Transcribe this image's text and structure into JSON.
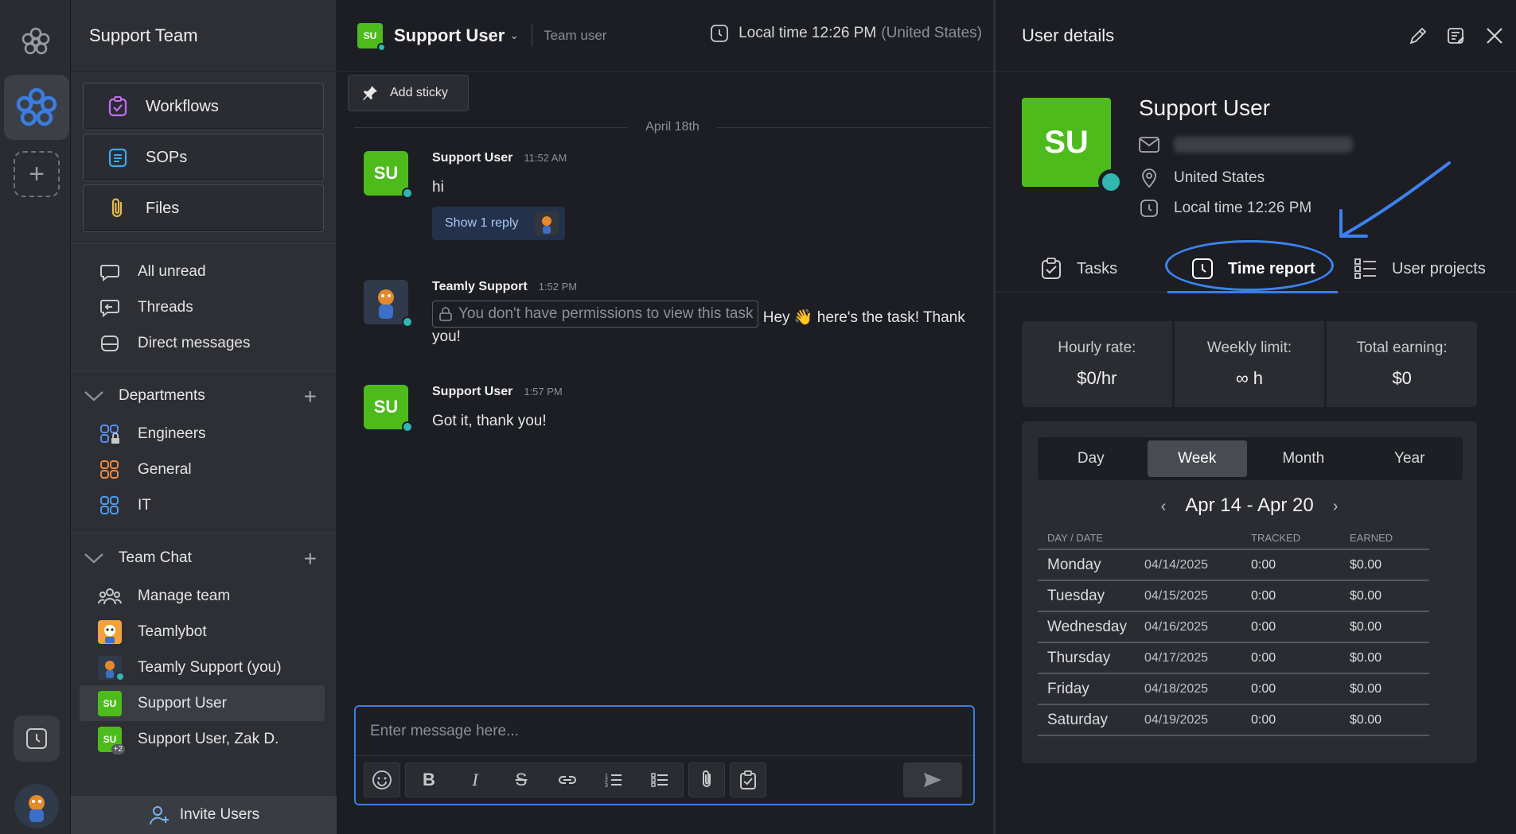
{
  "sidebar": {
    "team_name": "Support Team",
    "primary": [
      {
        "label": "Workflows",
        "icon": "workflows-icon",
        "color": "#c46df2"
      },
      {
        "label": "SOPs",
        "icon": "sops-icon",
        "color": "#3fa7f0"
      },
      {
        "label": "Files",
        "icon": "paperclip-icon",
        "color": "#e7b94a"
      }
    ],
    "quick": [
      {
        "label": "All unread",
        "icon": "all-unread-icon"
      },
      {
        "label": "Threads",
        "icon": "threads-icon"
      },
      {
        "label": "Direct messages",
        "icon": "direct-messages-icon"
      }
    ],
    "departments": {
      "title": "Departments",
      "items": [
        {
          "label": "Engineers",
          "color": "#5a8cf0"
        },
        {
          "label": "General",
          "color": "#f08a3e"
        },
        {
          "label": "IT",
          "color": "#4c9cf0"
        }
      ]
    },
    "team_chat": {
      "title": "Team Chat",
      "items": [
        {
          "label": "Manage team"
        },
        {
          "label": "Teamlybot"
        },
        {
          "label": "Teamly Support (you)"
        },
        {
          "label": "Support User",
          "avatar": "SU"
        },
        {
          "label": "Support User, Zak D.",
          "avatar": "SU",
          "badge": "+2"
        }
      ]
    },
    "invite_label": "Invite Users"
  },
  "chat": {
    "header": {
      "avatar": "SU",
      "name": "Support User",
      "role": "Team user",
      "local_time": "Local time 12:26 PM",
      "country": "(United States)"
    },
    "sticky_label": "Add sticky",
    "date_divider": "April 18th",
    "messages": [
      {
        "author": "Support User",
        "time": "11:52 AM",
        "text": "hi",
        "avatar": "SU",
        "reply_label": "Show 1 reply"
      },
      {
        "author": "Teamly Support",
        "time": "1:52 PM",
        "permission": "You don't have permissions to view this task",
        "text": "Hey 👋 here's the task! Thank",
        "text2": "you!"
      },
      {
        "author": "Support User",
        "time": "1:57 PM",
        "text": "Got it, thank you!",
        "avatar": "SU"
      }
    ],
    "composer_placeholder": "Enter message here..."
  },
  "panel": {
    "title": "User details",
    "user": {
      "initials": "SU",
      "name": "Support User",
      "location": "United States",
      "local_time": "Local time 12:26 PM"
    },
    "tabs": [
      {
        "label": "Tasks"
      },
      {
        "label": "Time report"
      },
      {
        "label": "User projects"
      }
    ],
    "stats": [
      {
        "label": "Hourly rate:",
        "value": "$0/hr"
      },
      {
        "label": "Weekly limit:",
        "value": "∞ h"
      },
      {
        "label": "Total earning:",
        "value": "$0"
      }
    ],
    "periods": [
      "Day",
      "Week",
      "Month",
      "Year"
    ],
    "range": "Apr 14 - Apr 20",
    "columns": [
      "DAY / DATE",
      "TRACKED",
      "EARNED"
    ],
    "rows": [
      {
        "day": "Monday",
        "date": "04/14/2025",
        "tracked": "0:00",
        "earned": "$0.00"
      },
      {
        "day": "Tuesday",
        "date": "04/15/2025",
        "tracked": "0:00",
        "earned": "$0.00"
      },
      {
        "day": "Wednesday",
        "date": "04/16/2025",
        "tracked": "0:00",
        "earned": "$0.00"
      },
      {
        "day": "Thursday",
        "date": "04/17/2025",
        "tracked": "0:00",
        "earned": "$0.00"
      },
      {
        "day": "Friday",
        "date": "04/18/2025",
        "tracked": "0:00",
        "earned": "$0.00"
      },
      {
        "day": "Saturday",
        "date": "04/19/2025",
        "tracked": "0:00",
        "earned": "$0.00"
      }
    ]
  },
  "colors": {
    "accent": "#3b7de0",
    "avatar_green": "#4dbb1c",
    "online": "#31b6b0"
  }
}
